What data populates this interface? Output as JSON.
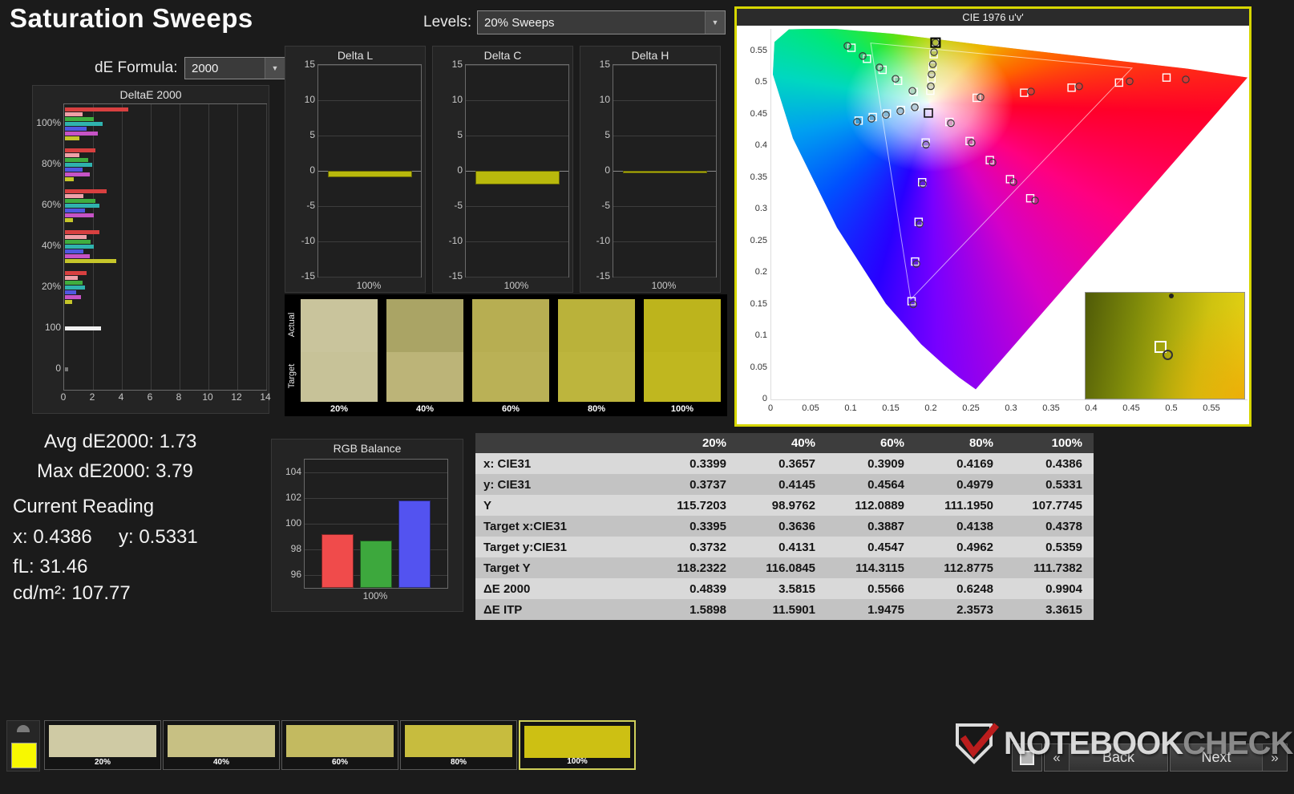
{
  "app": {
    "title": "Saturation Sweeps"
  },
  "controls": {
    "levels_label": "Levels:",
    "levels_value": "20% Sweeps",
    "de_formula_label": "dE Formula:",
    "de_formula_value": "2000"
  },
  "stats": {
    "avg": "Avg dE2000: 1.73",
    "max": "Max dE2000: 3.79",
    "current_heading": "Current Reading",
    "x": "x: 0.4386",
    "y": "y: 0.5331",
    "fl": "fL: 31.46",
    "luminance": "cd/m²: 107.77"
  },
  "chart_data": [
    {
      "id": "deltae_2000",
      "type": "bar",
      "title": "DeltaE 2000",
      "orientation": "horizontal",
      "xlim": [
        0,
        14
      ],
      "xticks": [
        0,
        2,
        4,
        6,
        8,
        10,
        12,
        14
      ],
      "bar_colors": [
        "#d84040",
        "#f0a0a8",
        "#3fae3f",
        "#2fb3ae",
        "#5058e0",
        "#c653c6",
        "#c6c62a"
      ],
      "groups": [
        {
          "label": "100%",
          "values": [
            4.4,
            1.2,
            2.0,
            2.6,
            1.5,
            2.3,
            0.99
          ]
        },
        {
          "label": "80%",
          "values": [
            2.1,
            1.0,
            1.6,
            1.9,
            1.2,
            1.7,
            0.62
          ]
        },
        {
          "label": "60%",
          "values": [
            2.9,
            1.3,
            2.1,
            2.4,
            1.4,
            2.0,
            0.56
          ]
        },
        {
          "label": "40%",
          "values": [
            2.4,
            1.5,
            1.8,
            2.0,
            1.3,
            1.7,
            3.58
          ]
        },
        {
          "label": "20%",
          "values": [
            1.5,
            0.9,
            1.2,
            1.4,
            0.8,
            1.1,
            0.48
          ]
        },
        {
          "label": "100",
          "values": [
            2.5
          ],
          "colors": [
            "#f0f0f0"
          ]
        },
        {
          "label": "0",
          "values": [
            0.2
          ],
          "colors": [
            "#777777"
          ]
        }
      ]
    },
    {
      "id": "delta_l",
      "type": "bar",
      "title": "Delta L",
      "ylim": [
        -15,
        15
      ],
      "yticks": [
        15,
        10,
        5,
        0,
        -5,
        -10,
        -15
      ],
      "categories": [
        "100%"
      ],
      "values": [
        -0.9
      ],
      "bar_color": "#b9b90c"
    },
    {
      "id": "delta_c",
      "type": "bar",
      "title": "Delta C",
      "ylim": [
        -15,
        15
      ],
      "yticks": [
        15,
        10,
        5,
        0,
        -5,
        -10,
        -15
      ],
      "categories": [
        "100%"
      ],
      "values": [
        -1.9
      ],
      "bar_color": "#b9b90c"
    },
    {
      "id": "delta_h",
      "type": "bar",
      "title": "Delta H",
      "ylim": [
        -15,
        15
      ],
      "yticks": [
        15,
        10,
        5,
        0,
        -5,
        -10,
        -15
      ],
      "categories": [
        "100%"
      ],
      "values": [
        -0.25
      ],
      "bar_color": "#b9b90c"
    },
    {
      "id": "rgb_balance",
      "type": "bar",
      "title": "RGB Balance",
      "ylim": [
        95,
        105
      ],
      "yticks": [
        104,
        102,
        100,
        98,
        96
      ],
      "categories": [
        "100%"
      ],
      "series": [
        {
          "name": "Red",
          "value": 99.2,
          "color": "#f04b4b"
        },
        {
          "name": "Green",
          "value": 98.7,
          "color": "#3da83d"
        },
        {
          "name": "Blue",
          "value": 101.8,
          "color": "#5353f0"
        }
      ]
    },
    {
      "id": "cie_1976",
      "type": "scatter",
      "title": "CIE 1976 u'v'",
      "xlim": [
        0,
        0.595
      ],
      "ylim": [
        0,
        0.585
      ],
      "xticks": [
        "0",
        "0.05",
        "0.1",
        "0.15",
        "0.2",
        "0.25",
        "0.3",
        "0.35",
        "0.4",
        "0.45",
        "0.5",
        "0.55"
      ],
      "yticks": [
        "0",
        "0.05",
        "0.1",
        "0.15",
        "0.2",
        "0.25",
        "0.3",
        "0.35",
        "0.4",
        "0.45",
        "0.5",
        "0.55"
      ],
      "white_point": [
        0.197,
        0.452
      ],
      "current": [
        0.2059,
        0.5631
      ],
      "locus": [
        [
          0.256,
          0.016
        ],
        [
          0.235,
          0.035
        ],
        [
          0.216,
          0.055
        ],
        [
          0.188,
          0.087
        ],
        [
          0.144,
          0.151
        ],
        [
          0.083,
          0.271
        ],
        [
          0.028,
          0.412
        ],
        [
          0.003,
          0.513
        ],
        [
          0.005,
          0.564
        ],
        [
          0.023,
          0.584
        ],
        [
          0.05,
          0.585
        ],
        [
          0.079,
          0.585
        ],
        [
          0.153,
          0.577
        ],
        [
          0.262,
          0.56
        ],
        [
          0.403,
          0.539
        ],
        [
          0.52,
          0.522
        ],
        [
          0.595,
          0.508
        ]
      ],
      "gamut_triangle": [
        [
          0.451,
          0.523
        ],
        [
          0.125,
          0.5625
        ],
        [
          0.175,
          0.158
        ]
      ],
      "sweeps": [
        {
          "name": "red",
          "targets": [
            [
              0.2572,
              0.476
            ],
            [
              0.3164,
              0.484
            ],
            [
              0.3756,
              0.492
            ],
            [
              0.4348,
              0.5
            ],
            [
              0.494,
              0.508
            ]
          ],
          "measured": [
            [
              0.262,
              0.477
            ],
            [
              0.325,
              0.486
            ],
            [
              0.385,
              0.494
            ],
            [
              0.448,
              0.502
            ],
            [
              0.518,
              0.505
            ]
          ]
        },
        {
          "name": "green",
          "targets": [
            [
              0.1786,
              0.4854
            ],
            [
              0.1592,
              0.5028
            ],
            [
              0.1398,
              0.5202
            ],
            [
              0.1204,
              0.5376
            ],
            [
              0.101,
              0.555
            ]
          ],
          "measured": [
            [
              0.177,
              0.487
            ],
            [
              0.156,
              0.506
            ],
            [
              0.136,
              0.524
            ],
            [
              0.115,
              0.542
            ],
            [
              0.096,
              0.558
            ]
          ]
        },
        {
          "name": "blue",
          "targets": [
            [
              0.1936,
              0.4054
            ],
            [
              0.1892,
              0.3428
            ],
            [
              0.1848,
              0.2802
            ],
            [
              0.1804,
              0.2176
            ],
            [
              0.176,
              0.155
            ]
          ],
          "measured": [
            [
              0.194,
              0.402
            ],
            [
              0.19,
              0.34
            ],
            [
              0.186,
              0.277
            ],
            [
              0.182,
              0.214
            ],
            [
              0.178,
              0.15
            ]
          ]
        },
        {
          "name": "cyan",
          "targets": [
            [
              0.1804,
              0.4624
            ],
            [
              0.1628,
              0.4568
            ],
            [
              0.1452,
              0.4512
            ],
            [
              0.1276,
              0.4456
            ],
            [
              0.11,
              0.44
            ]
          ],
          "measured": [
            [
              0.18,
              0.461
            ],
            [
              0.162,
              0.455
            ],
            [
              0.144,
              0.449
            ],
            [
              0.126,
              0.443
            ],
            [
              0.108,
              0.438
            ]
          ]
        },
        {
          "name": "magenta",
          "targets": [
            [
              0.2232,
              0.4379
            ],
            [
              0.2484,
              0.4078
            ],
            [
              0.2736,
              0.3777
            ],
            [
              0.2988,
              0.3476
            ],
            [
              0.324,
              0.3175
            ]
          ],
          "measured": [
            [
              0.225,
              0.436
            ],
            [
              0.251,
              0.405
            ],
            [
              0.277,
              0.374
            ],
            [
              0.303,
              0.343
            ],
            [
              0.33,
              0.314
            ]
          ]
        },
        {
          "name": "yellow",
          "targets": [
            [
              0.1994,
              0.4872
            ],
            [
              0.2008,
              0.5064
            ],
            [
              0.2022,
              0.5256
            ],
            [
              0.2036,
              0.5448
            ],
            [
              0.205,
              0.564
            ]
          ],
          "measured": [
            [
              0.2,
              0.4943
            ],
            [
              0.201,
              0.513
            ],
            [
              0.2025,
              0.529
            ],
            [
              0.204,
              0.548
            ],
            [
              0.2059,
              0.5631
            ]
          ]
        }
      ]
    }
  ],
  "swatch_panel": {
    "row_labels": [
      "Actual",
      "Target"
    ],
    "columns": [
      {
        "label": "20%",
        "actual": "#c9c49c",
        "target": "#c7c298"
      },
      {
        "label": "40%",
        "actual": "#aaa465",
        "target": "#bcb478"
      },
      {
        "label": "60%",
        "actual": "#b7ae52",
        "target": "#bab156"
      },
      {
        "label": "80%",
        "actual": "#bab23a",
        "target": "#bdb53d"
      },
      {
        "label": "100%",
        "actual": "#bdb41c",
        "target": "#c0b71f"
      }
    ]
  },
  "table": {
    "header": [
      "",
      "20%",
      "40%",
      "60%",
      "80%",
      "100%"
    ],
    "rows": [
      {
        "label": "x: CIE31",
        "values": [
          "0.3399",
          "0.3657",
          "0.3909",
          "0.4169",
          "0.4386"
        ]
      },
      {
        "label": "y: CIE31",
        "values": [
          "0.3737",
          "0.4145",
          "0.4564",
          "0.4979",
          "0.5331"
        ]
      },
      {
        "label": "Y",
        "values": [
          "115.7203",
          "98.9762",
          "112.0889",
          "111.1950",
          "107.7745"
        ]
      },
      {
        "label": "Target x:CIE31",
        "values": [
          "0.3395",
          "0.3636",
          "0.3887",
          "0.4138",
          "0.4378"
        ]
      },
      {
        "label": "Target y:CIE31",
        "values": [
          "0.3732",
          "0.4131",
          "0.4547",
          "0.4962",
          "0.5359"
        ]
      },
      {
        "label": "Target Y",
        "values": [
          "118.2322",
          "116.0845",
          "114.3115",
          "112.8775",
          "111.7382"
        ]
      },
      {
        "label": "ΔE 2000",
        "values": [
          "0.4839",
          "3.5815",
          "0.5566",
          "0.6248",
          "0.9904"
        ]
      },
      {
        "label": "ΔE ITP",
        "values": [
          "1.5898",
          "11.5901",
          "1.9475",
          "2.3573",
          "3.3615"
        ]
      }
    ]
  },
  "bottom_bar": {
    "indicator_color": "#f8f800",
    "swatches": [
      {
        "label": "20%",
        "color": "#cfcaa4",
        "selected": false
      },
      {
        "label": "40%",
        "color": "#c7c083",
        "selected": false
      },
      {
        "label": "60%",
        "color": "#c3ba60",
        "selected": false
      },
      {
        "label": "80%",
        "color": "#c7bc3e",
        "selected": false
      },
      {
        "label": "100%",
        "color": "#cdc013",
        "selected": true
      }
    ],
    "back_chevron": "«",
    "back_label": "Back",
    "next_label": "Next",
    "next_chevron": "»"
  },
  "watermark": {
    "brand_primary": "NOTEBOOK",
    "brand_secondary": "CHECK"
  }
}
